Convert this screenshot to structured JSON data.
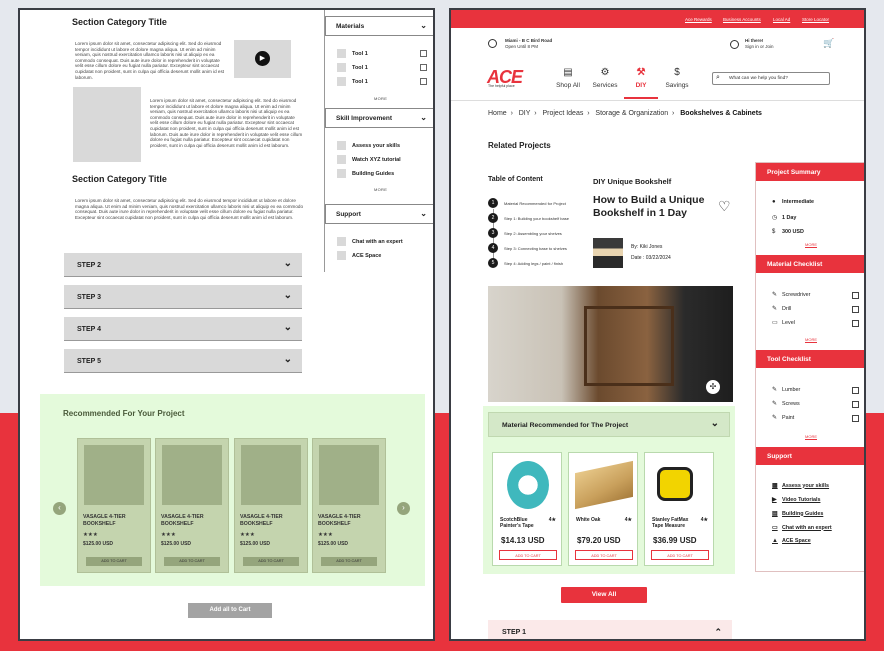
{
  "wireframe": {
    "section_title_1": "Section Category Title",
    "section_title_2": "Section Category Title",
    "para_1": "Lorem ipsum dolor sit amet, consectetur adipiscing elit. Sed do eiusmod tempor incididunt ut labore et dolore magna aliqua. Ut enim ad minim veniam, quis nostrud exercitation ullamco laboris nisi ut aliquip ex ea commodo consequat. Duis aute irure dolor in reprehenderit in voluptate velit esse cillum dolore eu fugiat nulla pariatur. Excepteur sint occaecat cupidatat non proident, sunt in culpa qui officia deserunt mollit anim id est laborum.",
    "para_2": "Lorem ipsum dolor sit amet, consectetur adipiscing elit. Sed do eiusmod tempor incididunt ut labore et dolore magna aliqua. Ut enim ad minim veniam, quis nostrud exercitation ullamco laboris nisi ut aliquip ex ea commodo consequat. Duis aute irure dolor in reprehenderit in voluptate velit esse cillum dolore eu fugiat nulla pariatur. Excepteur sint occaecat cupidatat non proident, sunt in culpa qui officia deserunt mollit anim id est laborum. Duis aute irure dolor in reprehenderit in voluptate velit esse cillum dolore eu fugiat nulla pariatur. Excepteur sint occaecat cupidatat non proident, sunt in culpa qui officia deserunt mollit anim id est laborum.",
    "para_3": "Lorem ipsum dolor sit amet, consectetur adipiscing elit. Sed do eiusmod tempor incididunt ut labore et dolore magna aliqua. Ut enim ad minim veniam, quis nostrud exercitation ullamco laboris nisi ut aliquip ex ea commodo consequat. Duis aute irure dolor in reprehenderit in voluptate velit esse cillum dolore eu fugiat nulla pariatur. Excepteur sint occaecat cupidatat non proident, sunt in culpa qui officia deserunt mollit anim id est laborum.",
    "sidebar": {
      "materials_title": "Materials",
      "tools": [
        "Tool 1",
        "Tool 1",
        "Tool 1"
      ],
      "more": "MORE",
      "skill_title": "Skill Improvement",
      "skills": [
        "Assess your skills",
        "Watch XYZ tutorial",
        "Building Guides"
      ],
      "more2": "MORE",
      "support_title": "Support",
      "support": [
        "Chat with an expert",
        "ACE Space"
      ]
    },
    "steps": [
      "STEP 2",
      "STEP 3",
      "STEP 4",
      "STEP 5"
    ],
    "recommended_title": "Recommended For Your Project",
    "products": [
      {
        "name": "VASAGLE 4-TIER BOOKSHELF",
        "stars": "★★★",
        "price": "$125.00 USD",
        "btn": "ADD TO CART"
      },
      {
        "name": "VASAGLE 4-TIER BOOKSHELF",
        "stars": "★★★",
        "price": "$125.00 USD",
        "btn": "ADD TO CART"
      },
      {
        "name": "VASAGLE 4-TIER BOOKSHELF",
        "stars": "★★★",
        "price": "$125.00 USD",
        "btn": "ADD TO CART"
      },
      {
        "name": "VASAGLE 4-TIER BOOKSHELF",
        "stars": "★★★",
        "price": "$125.00 USD",
        "btn": "ADD TO CART"
      }
    ],
    "add_all": "Add all to Cart"
  },
  "ace": {
    "top_links": [
      "Ace Rewards",
      "Business Accounts",
      "Local Ad",
      "Store Locator"
    ],
    "store": "Miami - B C Bird Road",
    "store_status": "Open Until 8 PM",
    "greeting": "Hi there!",
    "signin": "Sign in or Join",
    "logo": "ACE",
    "logo_tag": "The helpful place",
    "nav": [
      {
        "label": "Shop All",
        "icon": "▤"
      },
      {
        "label": "Services",
        "icon": "⚙"
      },
      {
        "label": "DIY",
        "icon": "⚒"
      },
      {
        "label": "Savings",
        "icon": "$"
      }
    ],
    "search_placeholder": "What can we help you find?",
    "breadcrumb": [
      "Home",
      "DIY",
      "Project Ideas",
      "Storage & Organization",
      "Bookshelves & Cabinets"
    ],
    "related_title": "Related Projects",
    "toc_title": "Table of Content",
    "toc": [
      {
        "n": "1",
        "label": "Material Recommended for Project"
      },
      {
        "n": "2",
        "label": "Step 1: Building your bookshelf base"
      },
      {
        "n": "3",
        "label": "Step 2: Assembling your shelves"
      },
      {
        "n": "4",
        "label": "Step 3: Connecting base to shelves"
      },
      {
        "n": "5",
        "label": "Step 4: Adding legs / paint / finish"
      }
    ],
    "kicker": "DIY Unique Bookshelf",
    "title": "How to Build a Unique Bookshelf in 1 Day",
    "author": "By: Kiki Jones",
    "date": "Date : 03/22/2024",
    "summary_title": "Project Summary",
    "summary": [
      {
        "icon": "●",
        "label": "Intermediate"
      },
      {
        "icon": "◷",
        "label": "1 Day"
      },
      {
        "icon": "$",
        "label": "300 USD"
      }
    ],
    "material_title": "Material Checklist",
    "materials": [
      {
        "icon": "✎",
        "label": "Screwdriver"
      },
      {
        "icon": "✎",
        "label": "Drill"
      },
      {
        "icon": "▭",
        "label": "Level"
      }
    ],
    "tool_title": "Tool Checklist",
    "tools": [
      {
        "icon": "✎",
        "label": "Lumber"
      },
      {
        "icon": "✎",
        "label": "Screws"
      },
      {
        "icon": "✎",
        "label": "Paint"
      }
    ],
    "support_title": "Support",
    "support": [
      {
        "icon": "▦",
        "label": "Assess your skills"
      },
      {
        "icon": "▶",
        "label": "Video Tutorials"
      },
      {
        "icon": "▤",
        "label": "Building Guides"
      },
      {
        "icon": "▭",
        "label": "Chat with an expert"
      },
      {
        "icon": "▲",
        "label": "ACE Space"
      }
    ],
    "more": "MORE",
    "material_rec_title": "Material Recommended for The Project",
    "mproducts": [
      {
        "name": "ScotchBlue Painter's Tape",
        "stars": "4★",
        "price": "$14.13 USD",
        "btn": "ADD TO CART"
      },
      {
        "name": "White Oak",
        "stars": "4★",
        "price": "$79.20 USD",
        "btn": "ADD TO CART"
      },
      {
        "name": "Stanley FatMax Tape Measure",
        "stars": "4★",
        "price": "$36.99 USD",
        "btn": "ADD TO CART"
      }
    ],
    "view_all": "View All",
    "step1": "STEP 1",
    "colors": {
      "ace_red": "#e8333d",
      "wire_green": "#e4fadb"
    }
  }
}
